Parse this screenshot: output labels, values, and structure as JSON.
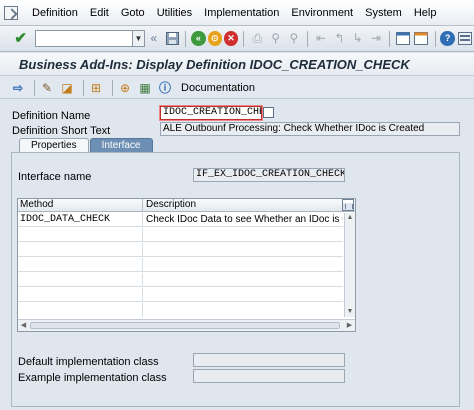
{
  "menu": {
    "items": [
      "Definition",
      "Edit",
      "Goto",
      "Utilities",
      "Implementation",
      "Environment",
      "System",
      "Help"
    ]
  },
  "system_toolbar": {
    "command_value": "",
    "icons": [
      "ok-check-icon",
      "save-icon",
      "back-icon",
      "exit-icon",
      "cancel-icon",
      "print-icon",
      "find-icon",
      "find-next-icon",
      "first-page-icon",
      "previous-page-icon",
      "next-page-icon",
      "last-page-icon",
      "new-session-icon",
      "shortcut-icon",
      "help-icon",
      "layout-menu-icon"
    ]
  },
  "title": "Business Add-Ins: Display Definition IDOC_CREATION_CHECK",
  "app_toolbar": {
    "documentation_label": "Documentation"
  },
  "header": {
    "definition_name_label": "Definition Name",
    "definition_name_value": "IDOC_CREATION_CHECK",
    "short_text_label": "Definition Short Text",
    "short_text_value": "ALE Outbounf Processing: Check Whether IDoc is Created"
  },
  "tabs": [
    {
      "label": "Properties",
      "active": false
    },
    {
      "label": "Interface",
      "active": true
    }
  ],
  "interface": {
    "interface_name_label": "Interface name",
    "interface_name_value": "IF_EX_IDOC_CREATION_CHECK",
    "table": {
      "columns": [
        "Method",
        "Description"
      ],
      "rows": [
        {
          "method": "IDOC_DATA_CHECK",
          "description": "Check IDoc Data to see Whether an IDoc is Genera"
        }
      ]
    },
    "default_impl_label": "Default implementation class",
    "default_impl_value": "",
    "example_impl_label": "Example implementation class",
    "example_impl_value": ""
  },
  "colors": {
    "active_tab": "#6d8fb3",
    "highlight_border": "#c12c2c",
    "background": "#dfe6ee"
  }
}
